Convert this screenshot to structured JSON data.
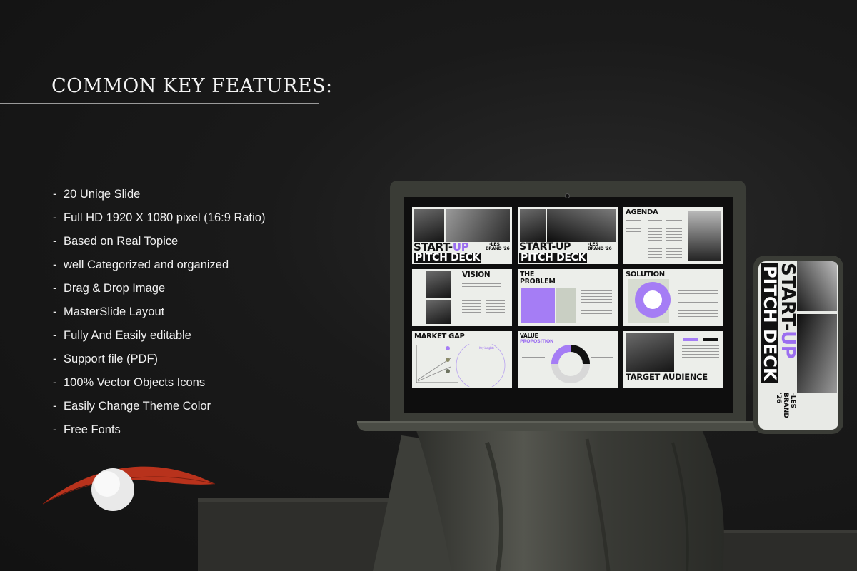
{
  "heading": "COMMON KEY FEATURES:",
  "features": [
    "20 Uniqe Slide",
    "Full HD 1920 X 1080 pixel (16:9 Ratio)",
    "Based on Real Topice",
    "well Categorized and organized",
    "Drag & Drop Image",
    "MasterSlide Layout",
    "Fully And Easily editable",
    "Support file (PDF)",
    "100% Vector Objects Icons",
    "Easily Change Theme Color",
    "Free Fonts"
  ],
  "slides": {
    "cover_a": {
      "start": "START-",
      "up": "UP",
      "les": "-LES",
      "brand": "BRAND '26",
      "pitch": "PITCH DECK"
    },
    "cover_b": {
      "start": "START-UP",
      "les": "-LES",
      "brand": "BRAND '26",
      "pitch": "PITCH DECK"
    },
    "agenda": "AGENDA",
    "vision": "VISION",
    "problem": "THE PROBLEM",
    "solution": "SOLUTION",
    "market_gap": "MARKET GAP",
    "key_insights": "Key insights",
    "value": "VALUE",
    "proposition": "PROPOSITION",
    "target": "TARGET AUDIENCE"
  },
  "phone": {
    "start": "START-",
    "up": "UP",
    "les": "-LES",
    "brand": "BRAND '26",
    "pitch": "PITCH DECK"
  },
  "colors": {
    "accent": "#9b6ef0",
    "background": "#141414"
  }
}
